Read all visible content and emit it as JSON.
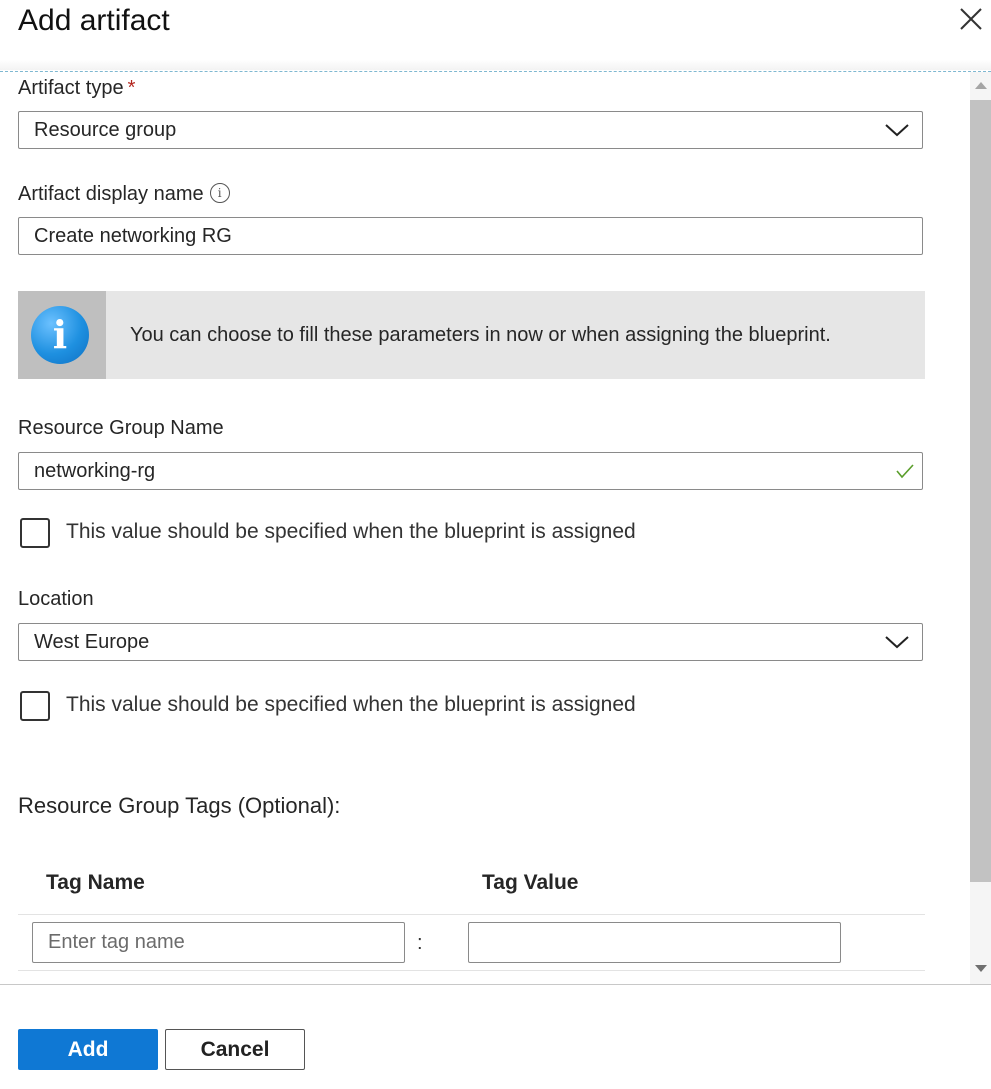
{
  "panel": {
    "title": "Add artifact"
  },
  "artifact_type": {
    "label": "Artifact type",
    "required_mark": "*",
    "value": "Resource group"
  },
  "display_name": {
    "label": "Artifact display name",
    "info_glyph": "i",
    "value": "Create networking RG"
  },
  "banner": {
    "icon": "info-icon",
    "icon_glyph": "i",
    "text": "You can choose to fill these parameters in now or when assigning the blueprint."
  },
  "resource_group_name": {
    "label": "Resource Group Name",
    "value": "networking-rg",
    "valid": true,
    "checkbox_label": "This value should be specified when the blueprint is assigned",
    "checkbox_checked": false
  },
  "location": {
    "label": "Location",
    "value": "West Europe",
    "checkbox_label": "This value should be specified when the blueprint is assigned",
    "checkbox_checked": false
  },
  "tags": {
    "heading": "Resource Group Tags (Optional):",
    "col_name": "Tag Name",
    "col_value": "Tag Value",
    "name_placeholder": "Enter tag name",
    "value_placeholder": "",
    "separator": ":"
  },
  "footer": {
    "add_label": "Add",
    "cancel_label": "Cancel"
  },
  "colors": {
    "primary": "#0f78d4",
    "valid_check": "#5a9e2b",
    "required": "#b3261e",
    "info_icon": "#1e90e0"
  }
}
